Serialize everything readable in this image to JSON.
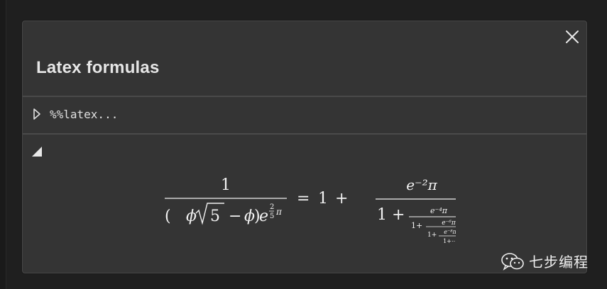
{
  "panel": {
    "title": "Latex formulas",
    "close_icon": "close-icon"
  },
  "code_cell": {
    "collapsed": true,
    "chevron_icon": "chevron-right-icon",
    "code": "%%latex..."
  },
  "output_cell": {
    "toggle_icon": "collapse-triangle-icon",
    "formula": {
      "lhs_numerator": "1",
      "lhs_denominator": "(ϕ√5 − ϕ)e^(2/5 π)",
      "equals": "=",
      "rhs_one": "1",
      "plus": "+",
      "frac_num": "e⁻²π",
      "den_one": "1",
      "den_plus": "+",
      "level2_num": "e⁻⁴π",
      "level2_den_one": "1+",
      "level3_num": "e⁻⁶π",
      "level3_den_one": "1+",
      "level4_num": "e⁻⁸π",
      "level4_den": "1+⋯",
      "exp_num": "2",
      "exp_den": "5",
      "exp_pi": "π",
      "sqrt_arg": "5",
      "phi": "ϕ",
      "minus": "−"
    }
  },
  "watermark": {
    "icon": "wechat-icon",
    "text": "七步编程"
  },
  "colors": {
    "background": "#1f1f1f",
    "panel": "#343434",
    "divider": "#4a4a4a",
    "text": "#e6e6e6"
  }
}
